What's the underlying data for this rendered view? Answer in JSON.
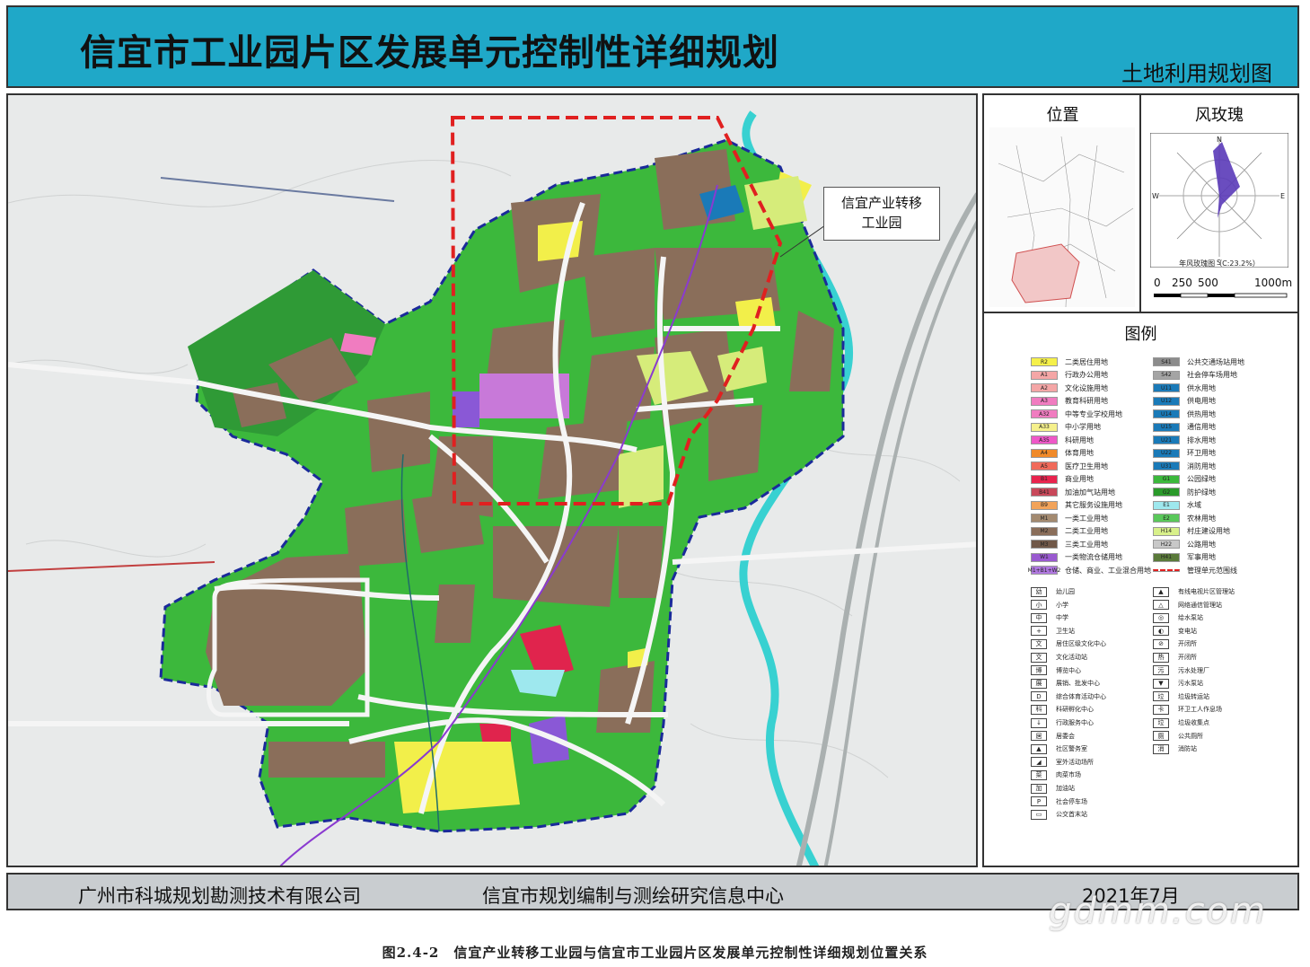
{
  "header": {
    "title": "信宜市工业园片区发展单元控制性详细规划",
    "subtitle": "土地利用规划图"
  },
  "map": {
    "callout_label_line1": "信宜产业转移",
    "callout_label_line2": "工业园",
    "colors": {
      "green_space": "#3cb83c",
      "forest": "#3a9a3a",
      "industrial": "#8a6e5a",
      "residential": "#f2ef4a",
      "education": "#c879d9",
      "commercial": "#e0244d",
      "water": "#38d1d1",
      "boundary_blue": "#1a2a9a",
      "boundary_red": "#e02020"
    }
  },
  "side": {
    "location_title": "位置",
    "windrose_title": "风玫瑰",
    "windrose_caption": "年风玫瑰图（C:23.2%）",
    "scale_labels": [
      "0",
      "250",
      "500",
      "1000m"
    ],
    "legend_title": "图例",
    "legend_left": [
      {
        "code": "R2",
        "label": "二类居住用地",
        "color": "#f5f04a"
      },
      {
        "code": "A1",
        "label": "行政办公用地",
        "color": "#f4a6a6"
      },
      {
        "code": "A2",
        "label": "文化设施用地",
        "color": "#f4a6a6"
      },
      {
        "code": "A3",
        "label": "教育科研用地",
        "color": "#f07cc0"
      },
      {
        "code": "A32",
        "label": "中等专业学校用地",
        "color": "#f07cc0"
      },
      {
        "code": "A33",
        "label": "中小学用地",
        "color": "#f5f08c"
      },
      {
        "code": "A35",
        "label": "科研用地",
        "color": "#ee58c8"
      },
      {
        "code": "A4",
        "label": "体育用地",
        "color": "#f08a2a"
      },
      {
        "code": "A5",
        "label": "医疗卫生用地",
        "color": "#f06a5a"
      },
      {
        "code": "B1",
        "label": "商业用地",
        "color": "#e8244e"
      },
      {
        "code": "B41",
        "label": "加油加气站用地",
        "color": "#c9485a"
      },
      {
        "code": "B9",
        "label": "其它服务设施用地",
        "color": "#f2a35a"
      },
      {
        "code": "M1",
        "label": "一类工业用地",
        "color": "#a38a70"
      },
      {
        "code": "M2",
        "label": "二类工业用地",
        "color": "#8a6e5a"
      },
      {
        "code": "M3",
        "label": "三类工业用地",
        "color": "#705848"
      },
      {
        "code": "W1",
        "label": "一类物流仓储用地",
        "color": "#9a5ad0"
      },
      {
        "code": "M1+B1+W2",
        "label": "仓储、商业、工业混合用地",
        "color": "#b078e0"
      }
    ],
    "legend_right": [
      {
        "code": "S41",
        "label": "公共交通场站用地",
        "color": "#8c8c8c"
      },
      {
        "code": "S42",
        "label": "社会停车场用地",
        "color": "#a4a4a4"
      },
      {
        "code": "U11",
        "label": "供水用地",
        "color": "#1a7ab8"
      },
      {
        "code": "U12",
        "label": "供电用地",
        "color": "#1a7ab8"
      },
      {
        "code": "U14",
        "label": "供热用地",
        "color": "#1a7ab8"
      },
      {
        "code": "U15",
        "label": "通信用地",
        "color": "#1a7ab8"
      },
      {
        "code": "U21",
        "label": "排水用地",
        "color": "#1a7ab8"
      },
      {
        "code": "U22",
        "label": "环卫用地",
        "color": "#1a7ab8"
      },
      {
        "code": "U31",
        "label": "消防用地",
        "color": "#1a7ab8"
      },
      {
        "code": "G1",
        "label": "公园绿地",
        "color": "#3cb83c"
      },
      {
        "code": "G2",
        "label": "防护绿地",
        "color": "#2a9a2a"
      },
      {
        "code": "E1",
        "label": "水域",
        "color": "#9ee8ee"
      },
      {
        "code": "E2",
        "label": "农林用地",
        "color": "#5ac85a"
      },
      {
        "code": "H14",
        "label": "村庄建设用地",
        "color": "#d8f08a"
      },
      {
        "code": "H22",
        "label": "公路用地",
        "color": "#c8c8c8"
      },
      {
        "code": "H41",
        "label": "军事用地",
        "color": "#5a7a3a"
      },
      {
        "code": "",
        "label": "管理单元范围线",
        "color": "#e02020"
      }
    ],
    "symbols_left": [
      {
        "glyph": "幼",
        "label": "幼儿园"
      },
      {
        "glyph": "小",
        "label": "小学"
      },
      {
        "glyph": "中",
        "label": "中学"
      },
      {
        "glyph": "+",
        "label": "卫生站"
      },
      {
        "glyph": "文",
        "label": "居住区级文化中心"
      },
      {
        "glyph": "文",
        "label": "文化活动站"
      },
      {
        "glyph": "博",
        "label": "博览中心"
      },
      {
        "glyph": "展",
        "label": "展销、批发中心"
      },
      {
        "glyph": "D",
        "label": "综合体育活动中心"
      },
      {
        "glyph": "科",
        "label": "科研孵化中心"
      },
      {
        "glyph": "↓",
        "label": "行政服务中心"
      },
      {
        "glyph": "居",
        "label": "居委会"
      },
      {
        "glyph": "▲",
        "label": "社区警务室"
      },
      {
        "glyph": "◢",
        "label": "室外活动场所"
      },
      {
        "glyph": "菜",
        "label": "肉菜市场"
      },
      {
        "glyph": "加",
        "label": "加油站"
      },
      {
        "glyph": "P",
        "label": "社会停车场"
      },
      {
        "glyph": "▭",
        "label": "公交首末站"
      }
    ],
    "symbols_right": [
      {
        "glyph": "▲",
        "label": "有线电视片区管理站"
      },
      {
        "glyph": "△",
        "label": "网络通信管理站"
      },
      {
        "glyph": "◎",
        "label": "给水泵站"
      },
      {
        "glyph": "◐",
        "label": "变电站"
      },
      {
        "glyph": "⊘",
        "label": "开闭所"
      },
      {
        "glyph": "热",
        "label": "开闭所"
      },
      {
        "glyph": "污",
        "label": "污水处理厂"
      },
      {
        "glyph": "▼",
        "label": "污水泵站"
      },
      {
        "glyph": "垃",
        "label": "垃圾转运站"
      },
      {
        "glyph": "卡",
        "label": "环卫工人作息场"
      },
      {
        "glyph": "垃",
        "label": "垃圾收集点"
      },
      {
        "glyph": "厕",
        "label": "公共厕所"
      },
      {
        "glyph": "消",
        "label": "消防站"
      }
    ]
  },
  "footer": {
    "company": "广州市科城规划勘测技术有限公司",
    "center": "信宜市规划编制与测绘研究信息中心",
    "date": "2021年7月"
  },
  "watermark": "gdmm.com",
  "caption": "图2.4-2　信宜产业转移工业园与信宜市工业园片区发展单元控制性详细规划位置关系"
}
